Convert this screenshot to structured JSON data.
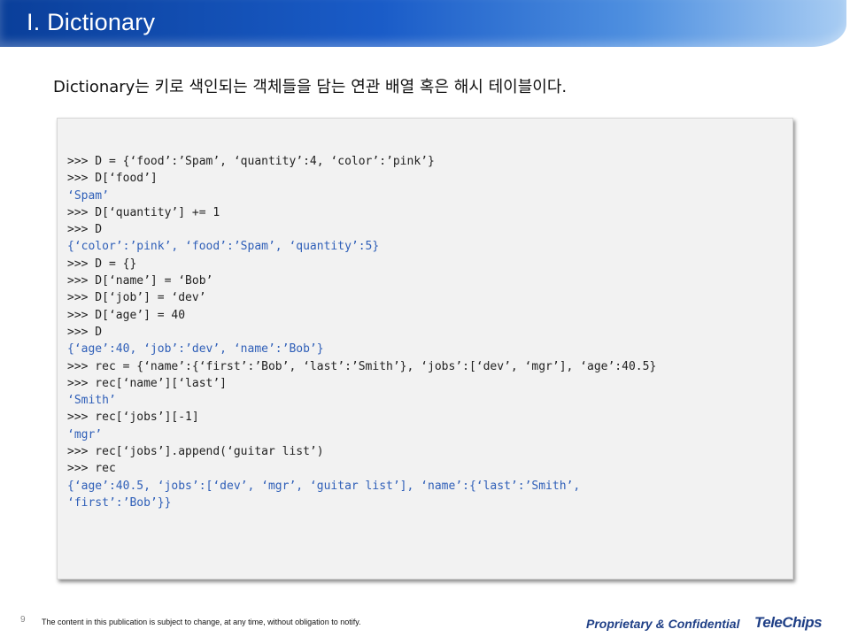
{
  "header": {
    "title": "I. Dictionary"
  },
  "intro": {
    "text": "Dictionary는 키로 색인되는 객체들을 담는 연관 배열 혹은 해시 테이블이다."
  },
  "code": {
    "lines": [
      {
        "text": ">>> D = {‘food’:’Spam’, ‘quantity’:4, ‘color’:’pink’}",
        "kind": "input"
      },
      {
        "text": ">>> D[‘food’]",
        "kind": "input"
      },
      {
        "text": "‘Spam’",
        "kind": "output"
      },
      {
        "text": ">>> D[‘quantity’] += 1",
        "kind": "input"
      },
      {
        "text": ">>> D",
        "kind": "input"
      },
      {
        "text": "{‘color’:’pink’, ‘food’:’Spam’, ‘quantity’:5}",
        "kind": "output"
      },
      {
        "text": ">>> D = {}",
        "kind": "input"
      },
      {
        "text": ">>> D[‘name’] = ‘Bob’",
        "kind": "input"
      },
      {
        "text": ">>> D[‘job’] = ‘dev’",
        "kind": "input"
      },
      {
        "text": ">>> D[‘age’] = 40",
        "kind": "input"
      },
      {
        "text": ">>> D",
        "kind": "input"
      },
      {
        "text": "{‘age’:40, ‘job’:’dev’, ‘name’:’Bob’}",
        "kind": "output"
      },
      {
        "text": ">>> rec = {‘name’:{‘first’:’Bob’, ‘last’:’Smith’}, ‘jobs’:[‘dev’, ‘mgr’], ‘age’:40.5}",
        "kind": "input"
      },
      {
        "text": ">>> rec[‘name’][‘last’]",
        "kind": "input"
      },
      {
        "text": "‘Smith’",
        "kind": "output"
      },
      {
        "text": ">>> rec[‘jobs’][-1]",
        "kind": "input"
      },
      {
        "text": "‘mgr’",
        "kind": "output"
      },
      {
        "text": ">>> rec[‘jobs’].append(‘guitar list’)",
        "kind": "input"
      },
      {
        "text": ">>> rec",
        "kind": "input"
      },
      {
        "text": "{‘age’:40.5, ‘jobs’:[‘dev’, ‘mgr’, ‘guitar list’], ‘name’:{‘last’:’Smith’,",
        "kind": "output"
      },
      {
        "text": "‘first’:’Bob’}}",
        "kind": "output"
      }
    ]
  },
  "footer": {
    "page_number": "9",
    "notice": "The content in this publication is subject to change, at any time, without obligation to notify.",
    "confidential": "Proprietary & Confidential",
    "logo_text": "TeleChips"
  },
  "colors": {
    "title_bar_start": "#0a3f9a",
    "title_bar_end": "#a9cdf3",
    "code_output": "#2f5fb8",
    "brand": "#1f3f86"
  }
}
